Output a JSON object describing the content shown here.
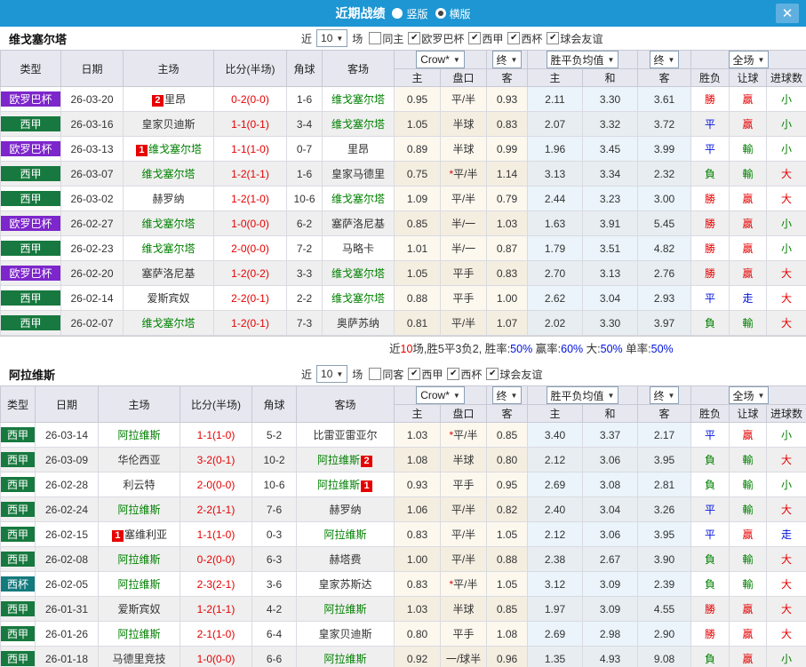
{
  "titlebar": {
    "title": "近期战绩",
    "vertical_label": "竖版",
    "horizontal_label": "横版",
    "selected_mode": "横版",
    "close_label": "✕"
  },
  "colors": {
    "europa": "#7d26cb",
    "laliga": "#17793f",
    "copa": "#137a7d",
    "titlebar_blue": "#1d96d3",
    "win_red": "#e60000",
    "draw_blue": "#0011dd",
    "loss_green": "#008000"
  },
  "table_header": {
    "left_cols": [
      "类型",
      "日期",
      "主场",
      "比分(半场)",
      "角球",
      "客场"
    ],
    "odds_select": "Crow*",
    "final_select": "终",
    "mean_select": "胜平负均值",
    "final_select2": "终",
    "full_select": "全场",
    "odds_sub": [
      "主",
      "盘口",
      "客"
    ],
    "mean_sub": [
      "主",
      "和",
      "客"
    ],
    "result_sub": [
      "胜负",
      "让球",
      "进球数"
    ]
  },
  "sections": [
    {
      "team": "维戈塞尔塔",
      "filter": {
        "near": "近",
        "count": "10",
        "games": "场",
        "same": {
          "label": "同主",
          "checked": false
        },
        "comps": [
          {
            "label": "欧罗巴杯",
            "checked": true
          },
          {
            "label": "西甲",
            "checked": true
          },
          {
            "label": "西杯",
            "checked": true
          },
          {
            "label": "球会友谊",
            "checked": true
          }
        ]
      },
      "rows": [
        {
          "comp": "欧罗巴杯",
          "key": "europa",
          "date": "26-03-20",
          "home": {
            "name": "里昂",
            "green": false,
            "badge": "2",
            "badge_pos": "before"
          },
          "score": "0-2(0-0)",
          "corners": "1-6",
          "away": {
            "name": "维戈塞尔塔",
            "green": true
          },
          "odds": {
            "h": "0.95",
            "line": "平/半",
            "star": false,
            "a": "0.93"
          },
          "mean": [
            "2.11",
            "3.30",
            "3.61"
          ],
          "res": [
            [
              "勝",
              "r"
            ],
            [
              "贏",
              "r"
            ],
            [
              "小",
              "g"
            ]
          ]
        },
        {
          "comp": "西甲",
          "key": "laliga",
          "date": "26-03-16",
          "home": {
            "name": "皇家贝迪斯",
            "green": false
          },
          "score": "1-1(0-1)",
          "corners": "3-4",
          "away": {
            "name": "维戈塞尔塔",
            "green": true
          },
          "odds": {
            "h": "1.05",
            "line": "半球",
            "star": false,
            "a": "0.83"
          },
          "mean": [
            "2.07",
            "3.32",
            "3.72"
          ],
          "res": [
            [
              "平",
              "b"
            ],
            [
              "贏",
              "r"
            ],
            [
              "小",
              "g"
            ]
          ]
        },
        {
          "comp": "欧罗巴杯",
          "key": "europa",
          "date": "26-03-13",
          "home": {
            "name": "维戈塞尔塔",
            "green": true,
            "badge": "1",
            "badge_pos": "before"
          },
          "score": "1-1(1-0)",
          "corners": "0-7",
          "away": {
            "name": "里昂",
            "green": false
          },
          "odds": {
            "h": "0.89",
            "line": "半球",
            "star": false,
            "a": "0.99"
          },
          "mean": [
            "1.96",
            "3.45",
            "3.99"
          ],
          "res": [
            [
              "平",
              "b"
            ],
            [
              "輸",
              "g"
            ],
            [
              "小",
              "g"
            ]
          ]
        },
        {
          "comp": "西甲",
          "key": "laliga",
          "date": "26-03-07",
          "home": {
            "name": "维戈塞尔塔",
            "green": true
          },
          "score": "1-2(1-1)",
          "corners": "1-6",
          "away": {
            "name": "皇家马德里",
            "green": false
          },
          "odds": {
            "h": "0.75",
            "line": "平/半",
            "star": true,
            "a": "1.14"
          },
          "mean": [
            "3.13",
            "3.34",
            "2.32"
          ],
          "res": [
            [
              "負",
              "g"
            ],
            [
              "輸",
              "g"
            ],
            [
              "大",
              "r"
            ]
          ]
        },
        {
          "comp": "西甲",
          "key": "laliga",
          "date": "26-03-02",
          "home": {
            "name": "赫罗纳",
            "green": false
          },
          "score": "1-2(1-0)",
          "corners": "10-6",
          "away": {
            "name": "维戈塞尔塔",
            "green": true
          },
          "odds": {
            "h": "1.09",
            "line": "平/半",
            "star": false,
            "a": "0.79"
          },
          "mean": [
            "2.44",
            "3.23",
            "3.00"
          ],
          "res": [
            [
              "勝",
              "r"
            ],
            [
              "贏",
              "r"
            ],
            [
              "大",
              "r"
            ]
          ]
        },
        {
          "comp": "欧罗巴杯",
          "key": "europa",
          "date": "26-02-27",
          "home": {
            "name": "维戈塞尔塔",
            "green": true
          },
          "score": "1-0(0-0)",
          "corners": "6-2",
          "away": {
            "name": "塞萨洛尼基",
            "green": false
          },
          "odds": {
            "h": "0.85",
            "line": "半/一",
            "star": false,
            "a": "1.03"
          },
          "mean": [
            "1.63",
            "3.91",
            "5.45"
          ],
          "res": [
            [
              "勝",
              "r"
            ],
            [
              "贏",
              "r"
            ],
            [
              "小",
              "g"
            ]
          ]
        },
        {
          "comp": "西甲",
          "key": "laliga",
          "date": "26-02-23",
          "home": {
            "name": "维戈塞尔塔",
            "green": true
          },
          "score": "2-0(0-0)",
          "corners": "7-2",
          "away": {
            "name": "马略卡",
            "green": false
          },
          "odds": {
            "h": "1.01",
            "line": "半/一",
            "star": false,
            "a": "0.87"
          },
          "mean": [
            "1.79",
            "3.51",
            "4.82"
          ],
          "res": [
            [
              "勝",
              "r"
            ],
            [
              "贏",
              "r"
            ],
            [
              "小",
              "g"
            ]
          ]
        },
        {
          "comp": "欧罗巴杯",
          "key": "europa",
          "date": "26-02-20",
          "home": {
            "name": "塞萨洛尼基",
            "green": false
          },
          "score": "1-2(0-2)",
          "corners": "3-3",
          "away": {
            "name": "维戈塞尔塔",
            "green": true
          },
          "odds": {
            "h": "1.05",
            "line": "平手",
            "star": false,
            "a": "0.83"
          },
          "mean": [
            "2.70",
            "3.13",
            "2.76"
          ],
          "res": [
            [
              "勝",
              "r"
            ],
            [
              "贏",
              "r"
            ],
            [
              "大",
              "r"
            ]
          ]
        },
        {
          "comp": "西甲",
          "key": "laliga",
          "date": "26-02-14",
          "home": {
            "name": "爱斯宾奴",
            "green": false
          },
          "score": "2-2(0-1)",
          "corners": "2-2",
          "away": {
            "name": "维戈塞尔塔",
            "green": true
          },
          "odds": {
            "h": "0.88",
            "line": "平手",
            "star": false,
            "a": "1.00"
          },
          "mean": [
            "2.62",
            "3.04",
            "2.93"
          ],
          "res": [
            [
              "平",
              "b"
            ],
            [
              "走",
              "b"
            ],
            [
              "大",
              "r"
            ]
          ]
        },
        {
          "comp": "西甲",
          "key": "laliga",
          "date": "26-02-07",
          "home": {
            "name": "维戈塞尔塔",
            "green": true
          },
          "score": "1-2(0-1)",
          "corners": "7-3",
          "away": {
            "name": "奥萨苏纳",
            "green": false
          },
          "odds": {
            "h": "0.81",
            "line": "平/半",
            "star": false,
            "a": "1.07"
          },
          "mean": [
            "2.02",
            "3.30",
            "3.97"
          ],
          "res": [
            [
              "負",
              "g"
            ],
            [
              "輸",
              "g"
            ],
            [
              "大",
              "r"
            ]
          ]
        }
      ],
      "summary": [
        {
          "t": "近",
          "c": "#333333"
        },
        {
          "t": "10",
          "c": "#e60000"
        },
        {
          "t": "场,胜5平3负2, 胜率:",
          "c": "#333333"
        },
        {
          "t": "50%",
          "c": "#0011dd"
        },
        {
          "t": " 赢率:",
          "c": "#333333"
        },
        {
          "t": "60%",
          "c": "#0011dd"
        },
        {
          "t": " 大:",
          "c": "#333333"
        },
        {
          "t": "50%",
          "c": "#0011dd"
        },
        {
          "t": " 单率:",
          "c": "#333333"
        },
        {
          "t": "50%",
          "c": "#0011dd"
        }
      ]
    },
    {
      "team": "阿拉维斯",
      "filter": {
        "near": "近",
        "count": "10",
        "games": "场",
        "same": {
          "label": "同客",
          "checked": false
        },
        "comps": [
          {
            "label": "西甲",
            "checked": true
          },
          {
            "label": "西杯",
            "checked": true
          },
          {
            "label": "球会友谊",
            "checked": true
          }
        ]
      },
      "rows": [
        {
          "comp": "西甲",
          "key": "laliga",
          "date": "26-03-14",
          "home": {
            "name": "阿拉维斯",
            "green": true
          },
          "score": "1-1(1-0)",
          "corners": "5-2",
          "away": {
            "name": "比雷亚雷亚尔",
            "green": false
          },
          "odds": {
            "h": "1.03",
            "line": "平/半",
            "star": true,
            "a": "0.85"
          },
          "mean": [
            "3.40",
            "3.37",
            "2.17"
          ],
          "res": [
            [
              "平",
              "b"
            ],
            [
              "贏",
              "r"
            ],
            [
              "小",
              "g"
            ]
          ]
        },
        {
          "comp": "西甲",
          "key": "laliga",
          "date": "26-03-09",
          "home": {
            "name": "华伦西亚",
            "green": false
          },
          "score": "3-2(0-1)",
          "corners": "10-2",
          "away": {
            "name": "阿拉维斯",
            "green": true,
            "badge": "2",
            "badge_pos": "after"
          },
          "odds": {
            "h": "1.08",
            "line": "半球",
            "star": false,
            "a": "0.80"
          },
          "mean": [
            "2.12",
            "3.06",
            "3.95"
          ],
          "res": [
            [
              "負",
              "g"
            ],
            [
              "輸",
              "g"
            ],
            [
              "大",
              "r"
            ]
          ]
        },
        {
          "comp": "西甲",
          "key": "laliga",
          "date": "26-02-28",
          "home": {
            "name": "利云特",
            "green": false
          },
          "score": "2-0(0-0)",
          "corners": "10-6",
          "away": {
            "name": "阿拉维斯",
            "green": true,
            "badge": "1",
            "badge_pos": "after"
          },
          "odds": {
            "h": "0.93",
            "line": "平手",
            "star": false,
            "a": "0.95"
          },
          "mean": [
            "2.69",
            "3.08",
            "2.81"
          ],
          "res": [
            [
              "負",
              "g"
            ],
            [
              "輸",
              "g"
            ],
            [
              "小",
              "g"
            ]
          ]
        },
        {
          "comp": "西甲",
          "key": "laliga",
          "date": "26-02-24",
          "home": {
            "name": "阿拉维斯",
            "green": true
          },
          "score": "2-2(1-1)",
          "corners": "7-6",
          "away": {
            "name": "赫罗纳",
            "green": false
          },
          "odds": {
            "h": "1.06",
            "line": "平/半",
            "star": false,
            "a": "0.82"
          },
          "mean": [
            "2.40",
            "3.04",
            "3.26"
          ],
          "res": [
            [
              "平",
              "b"
            ],
            [
              "輸",
              "g"
            ],
            [
              "大",
              "r"
            ]
          ]
        },
        {
          "comp": "西甲",
          "key": "laliga",
          "date": "26-02-15",
          "home": {
            "name": "塞维利亚",
            "green": false,
            "badge": "1",
            "badge_pos": "before"
          },
          "score": "1-1(1-0)",
          "corners": "0-3",
          "away": {
            "name": "阿拉维斯",
            "green": true
          },
          "odds": {
            "h": "0.83",
            "line": "平/半",
            "star": false,
            "a": "1.05"
          },
          "mean": [
            "2.12",
            "3.06",
            "3.95"
          ],
          "res": [
            [
              "平",
              "b"
            ],
            [
              "贏",
              "r"
            ],
            [
              "走",
              "b"
            ]
          ]
        },
        {
          "comp": "西甲",
          "key": "laliga",
          "date": "26-02-08",
          "home": {
            "name": "阿拉维斯",
            "green": true
          },
          "score": "0-2(0-0)",
          "corners": "6-3",
          "away": {
            "name": "赫塔费",
            "green": false
          },
          "odds": {
            "h": "1.00",
            "line": "平/半",
            "star": false,
            "a": "0.88"
          },
          "mean": [
            "2.38",
            "2.67",
            "3.90"
          ],
          "res": [
            [
              "負",
              "g"
            ],
            [
              "輸",
              "g"
            ],
            [
              "大",
              "r"
            ]
          ]
        },
        {
          "comp": "西杯",
          "key": "copa",
          "date": "26-02-05",
          "home": {
            "name": "阿拉维斯",
            "green": true
          },
          "score": "2-3(2-1)",
          "corners": "3-6",
          "away": {
            "name": "皇家苏斯达",
            "green": false
          },
          "odds": {
            "h": "0.83",
            "line": "平/半",
            "star": true,
            "a": "1.05"
          },
          "mean": [
            "3.12",
            "3.09",
            "2.39"
          ],
          "res": [
            [
              "負",
              "g"
            ],
            [
              "輸",
              "g"
            ],
            [
              "大",
              "r"
            ]
          ]
        },
        {
          "comp": "西甲",
          "key": "laliga",
          "date": "26-01-31",
          "home": {
            "name": "爱斯宾奴",
            "green": false
          },
          "score": "1-2(1-1)",
          "corners": "4-2",
          "away": {
            "name": "阿拉维斯",
            "green": true
          },
          "odds": {
            "h": "1.03",
            "line": "半球",
            "star": false,
            "a": "0.85"
          },
          "mean": [
            "1.97",
            "3.09",
            "4.55"
          ],
          "res": [
            [
              "勝",
              "r"
            ],
            [
              "贏",
              "r"
            ],
            [
              "大",
              "r"
            ]
          ]
        },
        {
          "comp": "西甲",
          "key": "laliga",
          "date": "26-01-26",
          "home": {
            "name": "阿拉维斯",
            "green": true
          },
          "score": "2-1(1-0)",
          "corners": "6-4",
          "away": {
            "name": "皇家贝迪斯",
            "green": false
          },
          "odds": {
            "h": "0.80",
            "line": "平手",
            "star": false,
            "a": "1.08"
          },
          "mean": [
            "2.69",
            "2.98",
            "2.90"
          ],
          "res": [
            [
              "勝",
              "r"
            ],
            [
              "贏",
              "r"
            ],
            [
              "大",
              "r"
            ]
          ]
        },
        {
          "comp": "西甲",
          "key": "laliga",
          "date": "26-01-18",
          "home": {
            "name": "马德里竞技",
            "green": false
          },
          "score": "1-0(0-0)",
          "corners": "6-6",
          "away": {
            "name": "阿拉维斯",
            "green": true
          },
          "odds": {
            "h": "0.92",
            "line": "一/球半",
            "star": false,
            "a": "0.96"
          },
          "mean": [
            "1.35",
            "4.93",
            "9.08"
          ],
          "res": [
            [
              "負",
              "g"
            ],
            [
              "贏",
              "r"
            ],
            [
              "小",
              "g"
            ]
          ]
        }
      ]
    }
  ]
}
